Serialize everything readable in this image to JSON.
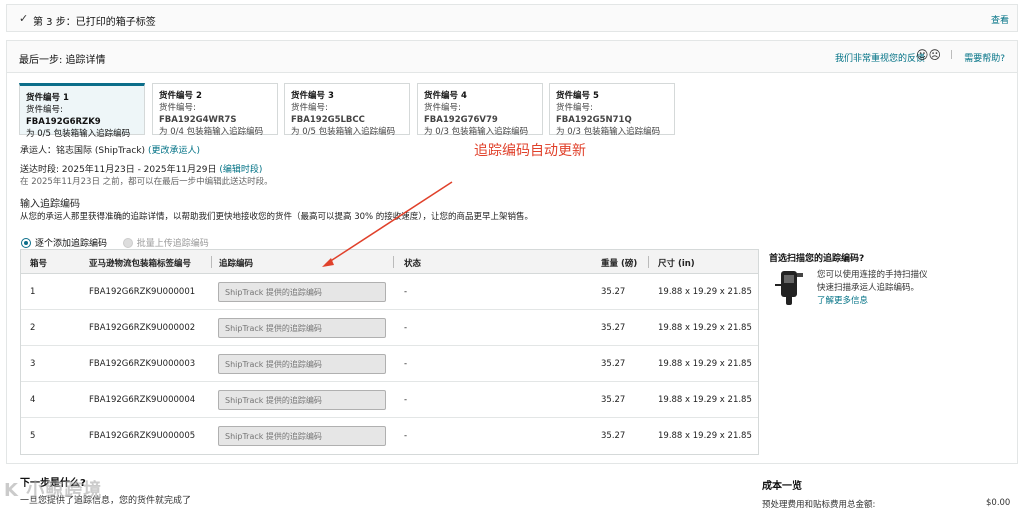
{
  "step3": {
    "check": "✓",
    "title": "第 3 步：已打印的箱子标签",
    "view": "查看"
  },
  "final": {
    "title": "最后一步: 追踪详情",
    "feedback": "我们非常重视您的反馈",
    "faces": "☺☹",
    "sep": "|",
    "help": "需要帮助?"
  },
  "shipments": [
    {
      "label": "货件编号 1",
      "id_prefix": "货件编号: ",
      "id": "FBA192G6RZK9",
      "status": "为 0/5 包装箱输入追踪编码"
    },
    {
      "label": "货件编号 2",
      "id_prefix": "货件编号: ",
      "id": "FBA192G4WR7S",
      "status": "为 0/4 包装箱输入追踪编码"
    },
    {
      "label": "货件编号 3",
      "id_prefix": "货件编号: ",
      "id": "FBA192G5LBCC",
      "status": "为 0/5 包装箱输入追踪编码"
    },
    {
      "label": "货件编号 4",
      "id_prefix": "货件编号: ",
      "id": "FBA192G76V79",
      "status": "为 0/3 包装箱输入追踪编码"
    },
    {
      "label": "货件编号 5",
      "id_prefix": "货件编号: ",
      "id": "FBA192G5N71Q",
      "status": "为 0/3 包装箱输入追踪编码"
    }
  ],
  "carrier": {
    "label": "承运人：铭志国际 (ShipTrack)",
    "change": "(更改承运人)"
  },
  "delivery": {
    "label": "送达时段: 2025年11月23日 - 2025年11月29日",
    "edit": "(编辑时段)",
    "note": "在 2025年11月23日 之前，都可以在最后一步中编辑此送达时段。"
  },
  "tracking": {
    "title": "输入追踪编码",
    "desc": "从您的承运人那里获得准确的追踪详情，以帮助我们更快地接收您的货件（最高可以提高 30% 的接收速度），让您的商品更早上架销售。",
    "option_individual": "逐个添加追踪编码",
    "option_bulk": "批量上传追踪编码"
  },
  "table": {
    "headers": {
      "box": "箱号",
      "label_id": "亚马逊物流包装箱标签编号",
      "tracking": "追踪编码",
      "status": "状态",
      "weight": "重量 (磅)",
      "size": "尺寸 (in)"
    },
    "placeholder": "ShipTrack 提供的追踪编码",
    "rows": [
      {
        "box": "1",
        "label_id": "FBA192G6RZK9U000001",
        "status": "-",
        "weight": "35.27",
        "size": "19.88 x 19.29 x 21.85"
      },
      {
        "box": "2",
        "label_id": "FBA192G6RZK9U000002",
        "status": "-",
        "weight": "35.27",
        "size": "19.88 x 19.29 x 21.85"
      },
      {
        "box": "3",
        "label_id": "FBA192G6RZK9U000003",
        "status": "-",
        "weight": "35.27",
        "size": "19.88 x 19.29 x 21.85"
      },
      {
        "box": "4",
        "label_id": "FBA192G6RZK9U000004",
        "status": "-",
        "weight": "35.27",
        "size": "19.88 x 19.29 x 21.85"
      },
      {
        "box": "5",
        "label_id": "FBA192G6RZK9U000005",
        "status": "-",
        "weight": "35.27",
        "size": "19.88 x 19.29 x 21.85"
      }
    ]
  },
  "scan": {
    "title": "首选扫描您的追踪编码?",
    "line1": "您可以使用连接的手持扫描仪",
    "line2": "快速扫描承运人追踪编码。",
    "link": "了解更多信息"
  },
  "annotation": "追踪编码自动更新",
  "next": {
    "title": "下一步是什么?",
    "text": "一旦您提供了追踪信息，您的货件就完成了"
  },
  "costs": {
    "title": "成本一览",
    "line": "预处理费用和贴标费用总金额:",
    "amount": "$0.00"
  },
  "watermark": "K 小鲸跨境",
  "colors": {
    "link": "#007185",
    "accent": "#0c6e8a",
    "annotation": "#e0412b"
  }
}
